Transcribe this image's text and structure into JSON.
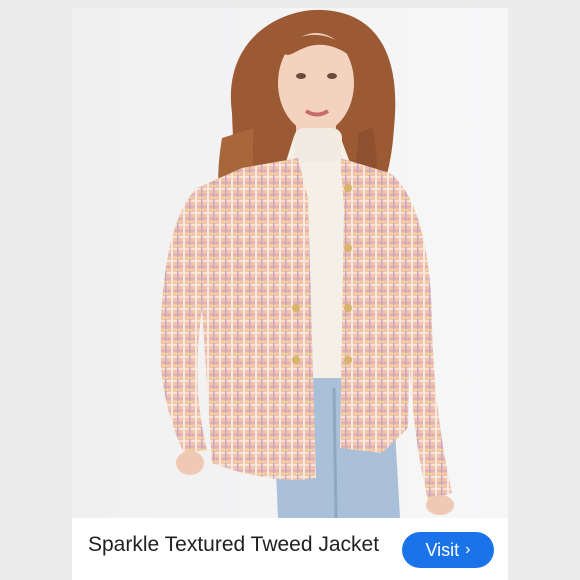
{
  "product": {
    "title": "Sparkle Textured Tweed Jacket"
  },
  "actions": {
    "visit_label": "Visit",
    "visit_icon": "chevron-right-icon"
  },
  "colors": {
    "accent": "#1a73e8",
    "jacket": "#efc0a8",
    "turtleneck": "#f4efe7",
    "denim": "#a9c0d8",
    "hair": "#9b5a33"
  }
}
